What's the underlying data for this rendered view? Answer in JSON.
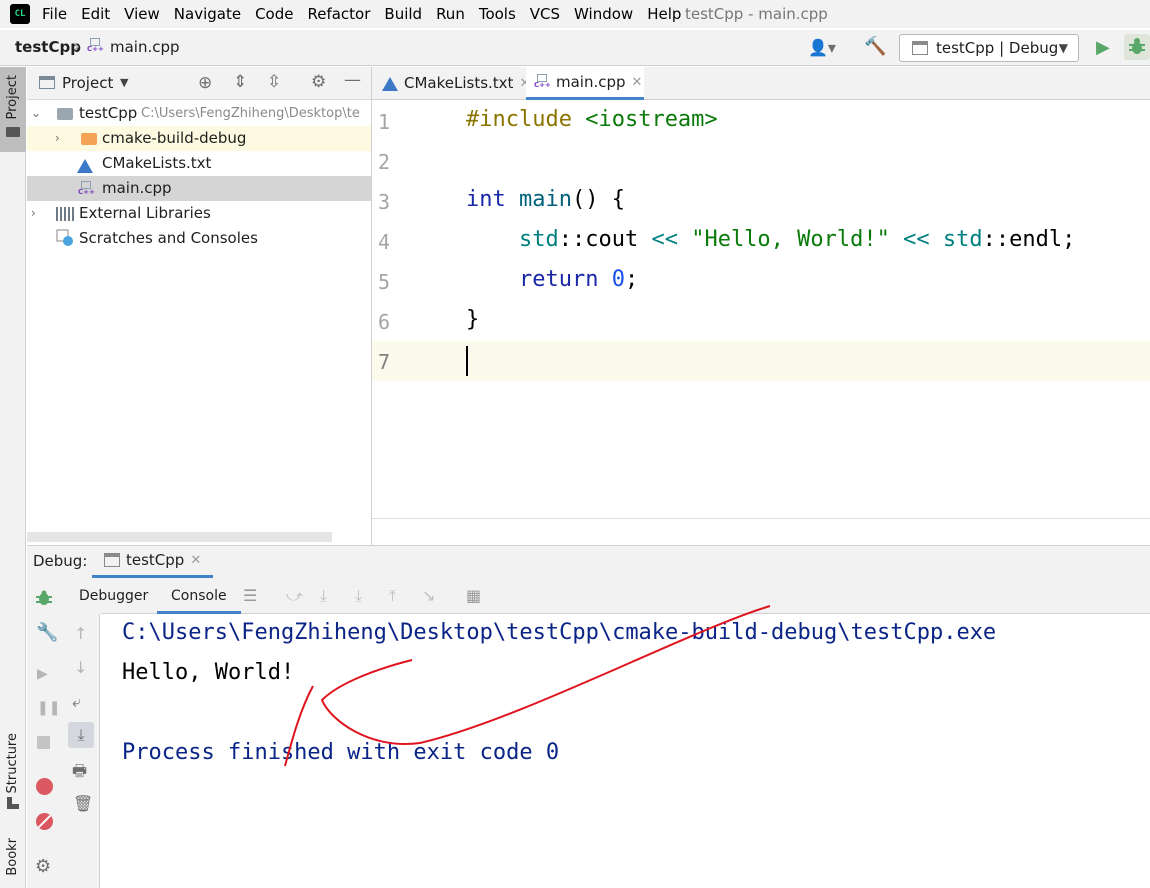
{
  "app": {
    "logo_text": "CL",
    "window_title": "testCpp - main.cpp"
  },
  "menu": [
    "File",
    "Edit",
    "View",
    "Navigate",
    "Code",
    "Refactor",
    "Build",
    "Run",
    "Tools",
    "VCS",
    "Window",
    "Help"
  ],
  "navbar": {
    "project": "testCpp",
    "file": "main.cpp",
    "run_config": "testCpp | Debug"
  },
  "left_strip": {
    "project": "Project",
    "structure": "Structure",
    "bookmarks": "Bookmarks"
  },
  "project_panel": {
    "title": "Project",
    "tree": [
      {
        "label": "testCpp",
        "path": "C:\\Users\\FengZhiheng\\Desktop\\te"
      },
      {
        "label": "cmake-build-debug"
      },
      {
        "label": "CMakeLists.txt"
      },
      {
        "label": "main.cpp"
      },
      {
        "label": "External Libraries"
      },
      {
        "label": "Scratches and Consoles"
      }
    ]
  },
  "editor": {
    "tabs": [
      "CMakeLists.txt",
      "main.cpp"
    ],
    "line_numbers": [
      "1",
      "2",
      "3",
      "4",
      "5",
      "6",
      "7"
    ],
    "code": {
      "l1_directive": "#include",
      "l1_header": "<iostream>",
      "l3_int": "int",
      "l3_main": "main",
      "l3_rest": "() {",
      "l4_std1": "std",
      "l4_cout": "::cout ",
      "l4_op1": "<<",
      "l4_str": "\"Hello, World!\"",
      "l4_op2": "<<",
      "l4_std2": "std",
      "l4_endl": "::endl;",
      "l5_return": "return",
      "l5_num": "0",
      "l5_semi": ";",
      "l6": "}"
    }
  },
  "debug": {
    "label": "Debug:",
    "tab": "testCpp",
    "subtabs": [
      "Debugger",
      "Console"
    ],
    "console": [
      "C:\\Users\\FengZhiheng\\Desktop\\testCpp\\cmake-build-debug\\testCpp.exe",
      "Hello, World!",
      "Process finished with exit code 0"
    ]
  },
  "colors": {
    "annotation": "#e0141e",
    "accent": "#4083c9"
  }
}
